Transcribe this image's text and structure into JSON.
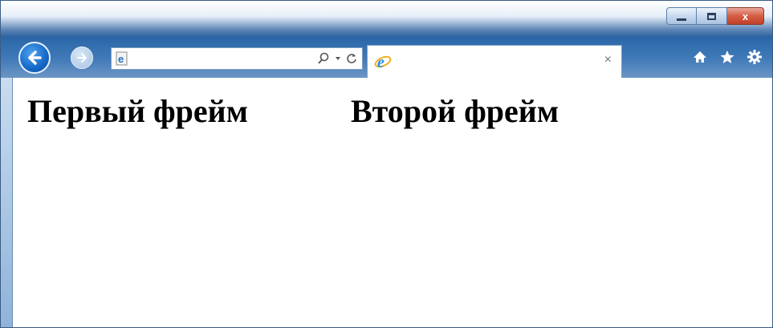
{
  "window": {
    "caption_buttons": {
      "minimize_icon": "minimize-icon",
      "maximize_icon": "maximize-icon",
      "close_label": "x"
    }
  },
  "navigation": {
    "back_icon": "back-arrow-icon",
    "forward_icon": "forward-arrow-icon"
  },
  "address_bar": {
    "url": "",
    "icons": [
      "ie-page-icon",
      "search-icon",
      "dropdown-arrow-icon",
      "refresh-icon"
    ]
  },
  "tab": {
    "title": "",
    "close_label": "×",
    "icon": "ie-icon"
  },
  "toolbar": {
    "icons": [
      "home-icon",
      "favorites-star-icon",
      "settings-gear-icon"
    ]
  },
  "content": {
    "frames": [
      {
        "text": "Первый фрейм"
      },
      {
        "text": "Второй фрейм"
      }
    ]
  },
  "colors": {
    "accent": "#1667c7",
    "close_button": "#c1402a",
    "page_background": "#ffffff"
  }
}
